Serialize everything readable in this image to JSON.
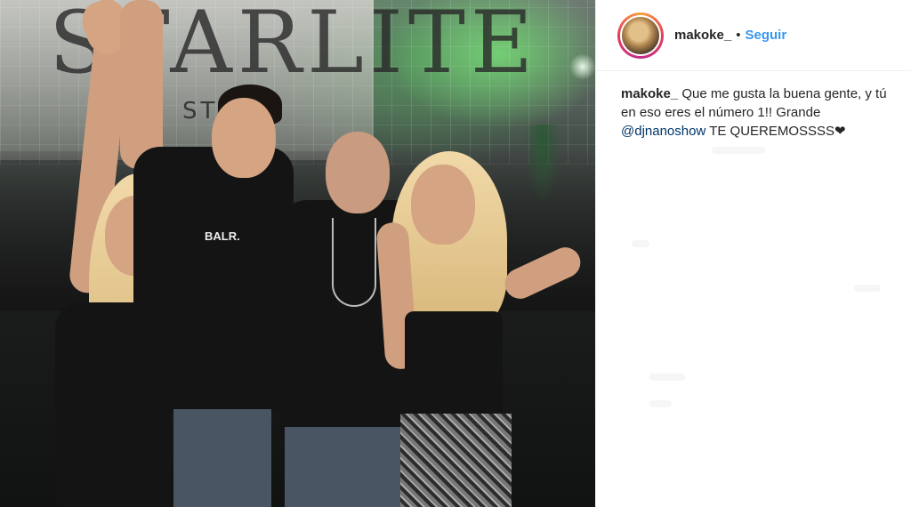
{
  "post": {
    "photo": {
      "sign_text": "STARLITE",
      "sign_sub": "STIVA",
      "shirt_print": "BALR."
    },
    "header": {
      "username": "makoke_",
      "separator": "•",
      "follow_label": "Seguir"
    },
    "caption": {
      "username": "makoke_",
      "text_before": " Que me gusta la buena gente, y tú en eso eres el número 1!! Grande ",
      "mention": "@djnanoshow",
      "text_after": " TE QUEREMOSSSS❤"
    }
  },
  "colors": {
    "link_blue": "#3897f0",
    "mention_blue": "#003569",
    "text_dark": "#262626",
    "divider": "#efefef"
  },
  "icons": [
    "avatar-ring"
  ]
}
